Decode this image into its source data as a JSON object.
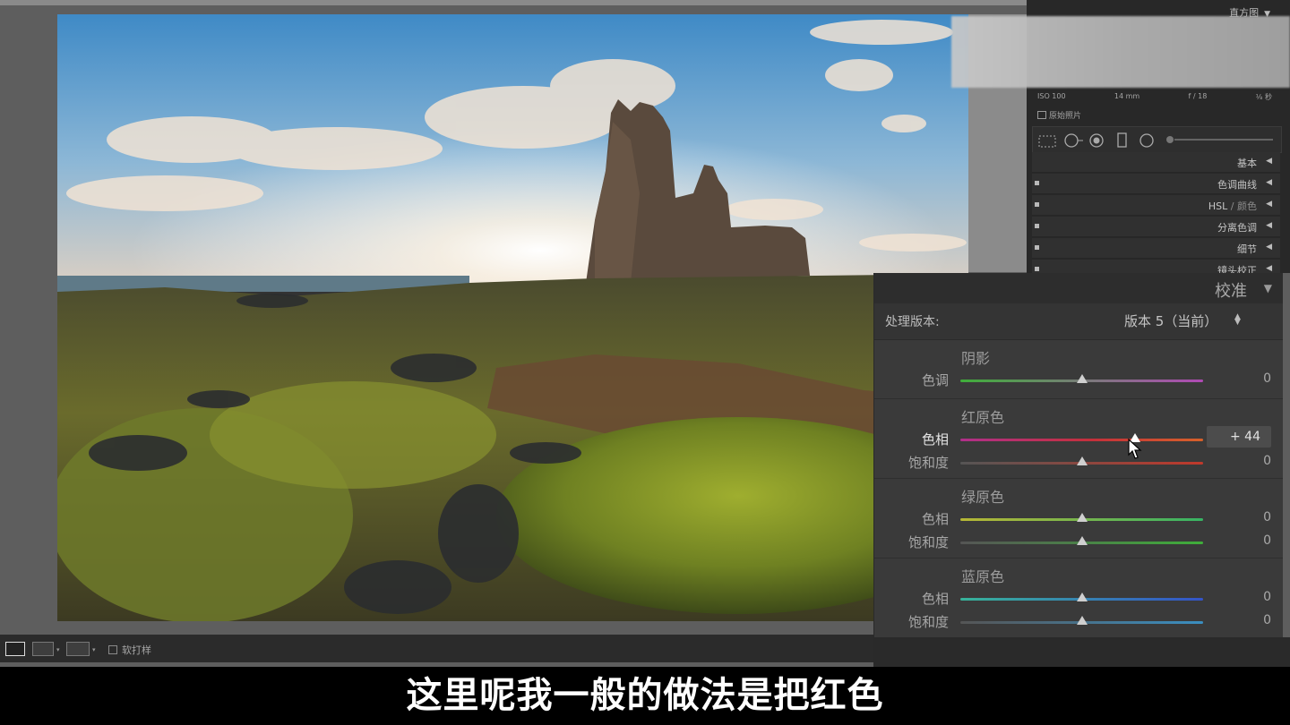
{
  "right_panel": {
    "histogram_title": "直方图",
    "meta": {
      "iso": "ISO 100",
      "focal": "14 mm",
      "aperture": "f / 18",
      "shutter": "⅛ 秒"
    },
    "original_photo": "原始照片",
    "sections": [
      {
        "label": "基本",
        "has_switch": false
      },
      {
        "label": "色调曲线",
        "has_switch": true
      },
      {
        "label": "HSL",
        "label_dim": " / 颜色",
        "has_switch": true
      },
      {
        "label": "分离色调",
        "has_switch": true
      },
      {
        "label": "细节",
        "has_switch": true
      },
      {
        "label": "镜头校正",
        "has_switch": true
      }
    ]
  },
  "calibration": {
    "title": "校准",
    "process_label": "处理版本:",
    "process_value": "版本 5（当前）",
    "groups": [
      {
        "title": "阴影",
        "sliders": [
          {
            "label": "色调",
            "value": 0,
            "display": "0"
          }
        ]
      },
      {
        "title": "红原色",
        "sliders": [
          {
            "label": "色相",
            "value": 44,
            "display": "+ 44",
            "active": true
          },
          {
            "label": "饱和度",
            "value": 0,
            "display": "0"
          }
        ]
      },
      {
        "title": "绿原色",
        "sliders": [
          {
            "label": "色相",
            "value": 0,
            "display": "0"
          },
          {
            "label": "饱和度",
            "value": 0,
            "display": "0"
          }
        ]
      },
      {
        "title": "蓝原色",
        "sliders": [
          {
            "label": "色相",
            "value": 0,
            "display": "0"
          },
          {
            "label": "饱和度",
            "value": 0,
            "display": "0"
          }
        ]
      }
    ],
    "slider_range": [
      -100,
      100
    ]
  },
  "toolbar": {
    "view_buttons": [
      "loupe-view",
      "before-after-view",
      "yy-view"
    ],
    "soft_proof": "软打样"
  },
  "subtitle": "这里呢我一般的做法是把红色"
}
